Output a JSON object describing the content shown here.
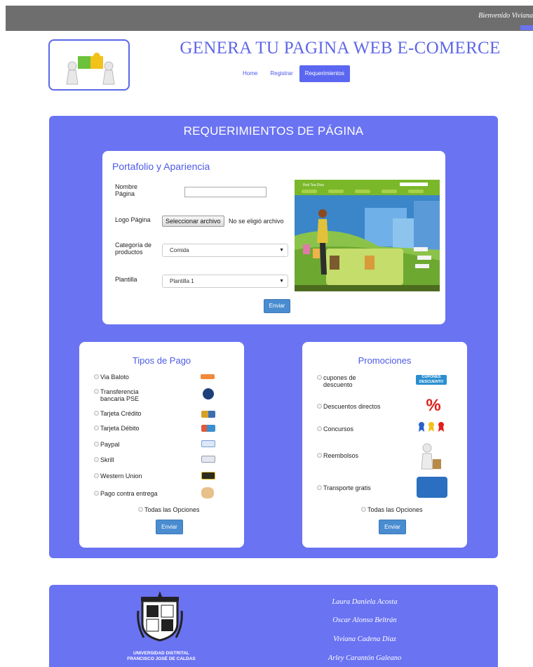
{
  "topbar": {
    "welcome": "Bienvenido Viviana"
  },
  "header": {
    "title": "GENERA TU PAGINA WEB E-COMERCE",
    "nav": [
      "Home",
      "Registrar",
      "Requerimientos"
    ]
  },
  "main": {
    "title": "REQUERIMIENTOS DE PÁGINA"
  },
  "portfolio": {
    "title": "Portafolio y Apariencia",
    "name_label_1": "Nombre",
    "name_label_2": "Página",
    "name_value": "",
    "logo_label": "Logo Página",
    "file_button": "Seleccionar archivo",
    "file_status": "No se eligió archivo",
    "category_label_1": "Categoría de",
    "category_label_2": "productos",
    "category_value": "Comida",
    "template_label": "Plantilla",
    "template_value": "Plantilla 1",
    "submit": "Enviar",
    "preview_brand": "Red Tea Diva"
  },
  "payments": {
    "title": "Tipos de Pago",
    "options": [
      "Via Baloto",
      "Transferencia",
      "bancaria PSE",
      "Tarjeta Crédito",
      "Tarjeta Débito",
      "Paypal",
      "Skrill",
      "Western Union",
      "Pago contra entrega"
    ],
    "all": "Todas las Opciones",
    "submit": "Enviar"
  },
  "promotions": {
    "title": "Promociones",
    "options": [
      "cupones de",
      "descuento",
      "Descuentos directos",
      "Concursos",
      "Reembolsos",
      "Transporte gratis"
    ],
    "all": "Todas las Opciones",
    "submit": "Enviar",
    "coupon_badge": "CUPONES DESCUENTO",
    "percent_sign": "%"
  },
  "footer": {
    "university_1": "UNIVERSIDAD DISTRITAL",
    "university_2": "FRANCISCO JOSÉ DE CALDAS",
    "authors": [
      "Laura Daniela Acosta",
      "Oscar Alonso Beltrán",
      "Viviana Cadena Díaz",
      "Arley Carantón Galeano"
    ]
  },
  "colors": {
    "accent": "#6a73f2",
    "title": "#5f67e6",
    "button": "#4a8cd0",
    "topbar": "#6e6e6e"
  }
}
